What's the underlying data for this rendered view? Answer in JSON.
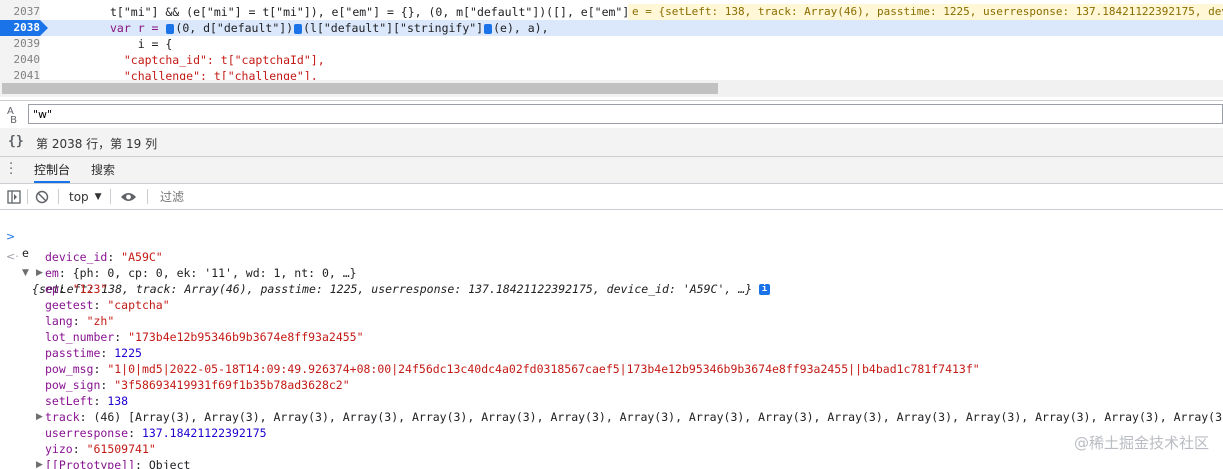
{
  "editor": {
    "lines": [
      {
        "num": "2037",
        "code": "t[\"mi\"] && (e[\"mi\"] = t[\"mi\"]), e[\"em\"] = {}, (0, m[\"default\"])([], e[\"em\"]);"
      },
      {
        "num": "2038",
        "code_a": "var r = ",
        "code_b": "(0, d[\"default\"])",
        "code_c": "(l[\"default\"][\"stringify\"]",
        "code_d": "(e), a),"
      },
      {
        "num": "2039",
        "code": "    i = {"
      },
      {
        "num": "2040",
        "code": "  \"captcha_id\": t[\"captchaId\"],"
      },
      {
        "num": "2041",
        "code": "  \"challenge\": t[\"challenge\"],"
      }
    ],
    "inline_value": "e = {setLeft: 138, track: Array(46), passtime: 1225, userresponse: 137.18421122392175, dev"
  },
  "search": {
    "value": "\"w\""
  },
  "status": {
    "position_text": "第 2038 行，第 19 列"
  },
  "drawer": {
    "tabs": [
      "控制台",
      "搜索"
    ]
  },
  "console_toolbar": {
    "context": "top",
    "filter_placeholder": "过滤"
  },
  "console": {
    "input": "e",
    "summary": {
      "open": "{",
      "text": "setLeft: 138, track: Array(46), passtime: 1225, userresponse: 137.18421122392175, device_id: 'A59C', …}",
      "info": "i"
    },
    "props": [
      {
        "key": "device_id",
        "value": "\"A59C\"",
        "kind": "str"
      },
      {
        "key": "em",
        "value": "{ph: 0, cp: 0, ek: '11', wd: 1, nt: 0, …}",
        "kind": "obj",
        "expandable": true
      },
      {
        "key": "ep",
        "value": "\"123\"",
        "kind": "str"
      },
      {
        "key": "geetest",
        "value": "\"captcha\"",
        "kind": "str"
      },
      {
        "key": "lang",
        "value": "\"zh\"",
        "kind": "str"
      },
      {
        "key": "lot_number",
        "value": "\"173b4e12b95346b9b3674e8ff93a2455\"",
        "kind": "str"
      },
      {
        "key": "passtime",
        "value": "1225",
        "kind": "num"
      },
      {
        "key": "pow_msg",
        "value": "\"1|0|md5|2022-05-18T14:09:49.926374+08:00|24f56dc13c40dc4a02fd0318567caef5|173b4e12b95346b9b3674e8ff93a2455||b4bad1c781f7413f\"",
        "kind": "str"
      },
      {
        "key": "pow_sign",
        "value": "\"3f58693419931f69f1b35b78ad3628c2\"",
        "kind": "str"
      },
      {
        "key": "setLeft",
        "value": "138",
        "kind": "num"
      },
      {
        "key": "track",
        "value": "(46) [Array(3), Array(3), Array(3), Array(3), Array(3), Array(3), Array(3), Array(3), Array(3), Array(3), Array(3), Array(3), Array(3), Array(3), Array(3), Array(3), Array(",
        "kind": "obj",
        "expandable": true
      },
      {
        "key": "userresponse",
        "value": "137.18421122392175",
        "kind": "num"
      },
      {
        "key": "yizo",
        "value": "\"61509741\"",
        "kind": "str"
      },
      {
        "key": "[[Prototype]]",
        "value": "Object",
        "kind": "obj",
        "expandable": true
      }
    ]
  },
  "watermark": "@稀土掘金技术社区"
}
